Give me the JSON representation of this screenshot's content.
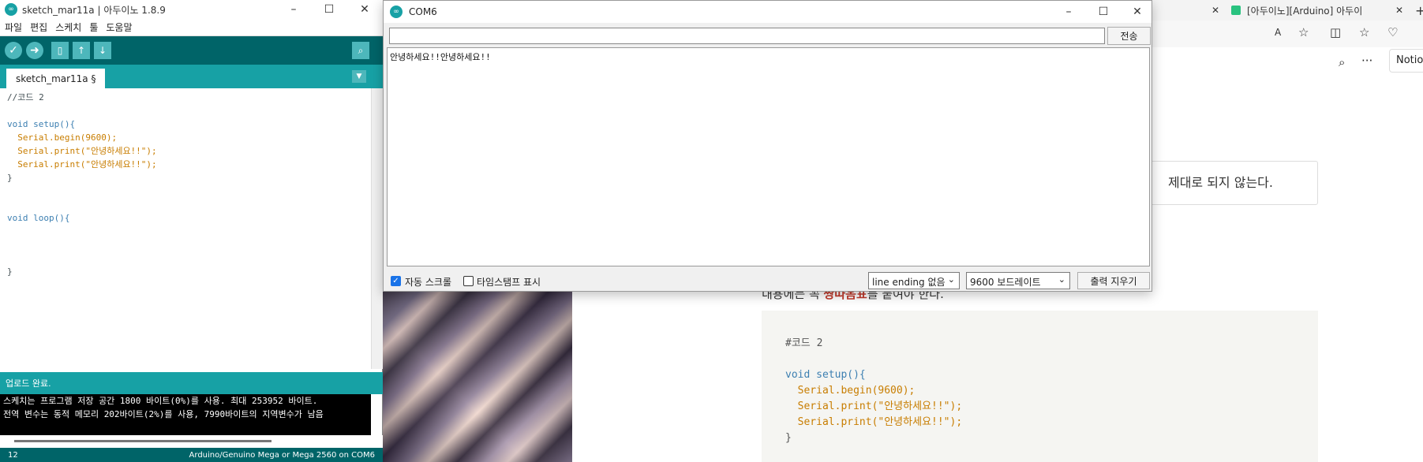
{
  "ide": {
    "title": "sketch_mar11a | 아두이노 1.8.9",
    "menu": [
      "파일",
      "편집",
      "스케치",
      "툴",
      "도움말"
    ],
    "tab_label": "sketch_mar11a §",
    "code_lines": [
      "//코드 2",
      "",
      "void setup(){",
      "  Serial.begin(9600);",
      "  Serial.print(\"안녕하세요!!\");",
      "  Serial.print(\"안녕하세요!!\");",
      "}",
      "",
      "",
      "void loop(){",
      "",
      "",
      "",
      "}"
    ],
    "status": "업로드 완료.",
    "console_lines": [
      "스케치는 프로그램 저장 공간 1800 바이트(0%)를 사용. 최대 253952 바이트.",
      "전역 변수는 동적 메모리 202바이트(2%)를 사용, 7990바이트의 지역변수가 남음"
    ],
    "line_number": "12",
    "board_info": "Arduino/Genuino Mega or Mega 2560 on COM6"
  },
  "serial": {
    "title": "COM6",
    "input_value": "",
    "send_label": "전송",
    "output": "안녕하세요!!안녕하세요!!",
    "autoscroll_label": "자동 스크롤",
    "autoscroll_checked": true,
    "timestamp_label": "타임스탬프 표시",
    "timestamp_checked": false,
    "line_ending": "line ending 없음",
    "baud": "9600 보드레이트",
    "clear_label": "출력 지우기"
  },
  "browser": {
    "tab2_title": "[아두이노][Arduino] 아두이",
    "notion_label": "Notio",
    "callout_text": "제대로 되지 않는다.",
    "partial_text_prefix": "내용에는 꼭 ",
    "partial_text_bold": "쌍따옴표",
    "partial_text_suffix": "를 붙여야 한다.",
    "code_lines": [
      "#코드 2",
      "",
      "void setup(){",
      "  Serial.begin(9600);",
      "  Serial.print(\"안녕하세요!!\");",
      "  Serial.print(\"안녕하세요!!\");",
      "}"
    ]
  },
  "colors": {
    "arduino_teal_dark": "#006468",
    "arduino_teal": "#17a1a5",
    "arduino_button": "#4db7bb"
  }
}
